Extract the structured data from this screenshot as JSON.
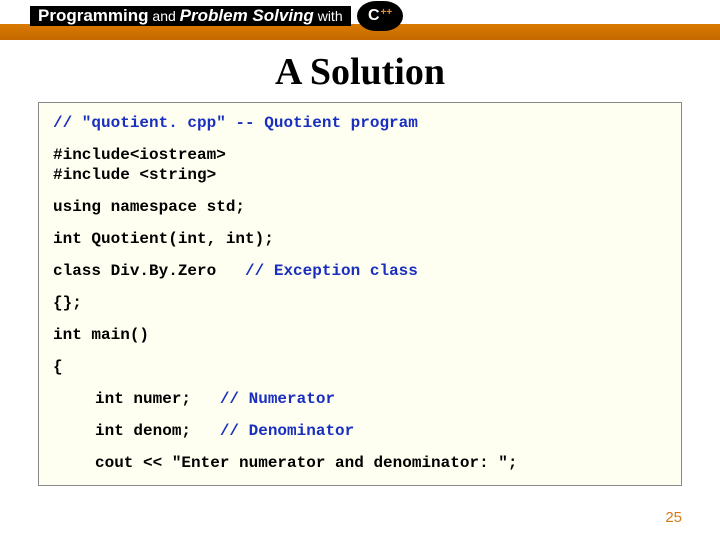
{
  "header": {
    "prog": "Programming",
    "and": " and ",
    "ps": "Problem Solving",
    "with": " with",
    "logo_c": "C",
    "logo_pp": "++"
  },
  "title": "A Solution",
  "code": {
    "l1": "// \"quotient. cpp\" -- Quotient program",
    "l2": "#include<iostream>",
    "l3": "#include <string>",
    "l4": "using namespace std;",
    "l5": "int Quotient(int, int);",
    "l6a": "class Div.By.Zero",
    "l6b": "   // Exception class",
    "l7": "{};",
    "l8": "int main()",
    "l9": "{",
    "l10a": "int numer;",
    "l10b": "   // Numerator",
    "l11a": "int denom;",
    "l11b": "   // Denominator",
    "l12": "cout << \"Enter numerator and denominator: \";"
  },
  "pagenum": "25"
}
